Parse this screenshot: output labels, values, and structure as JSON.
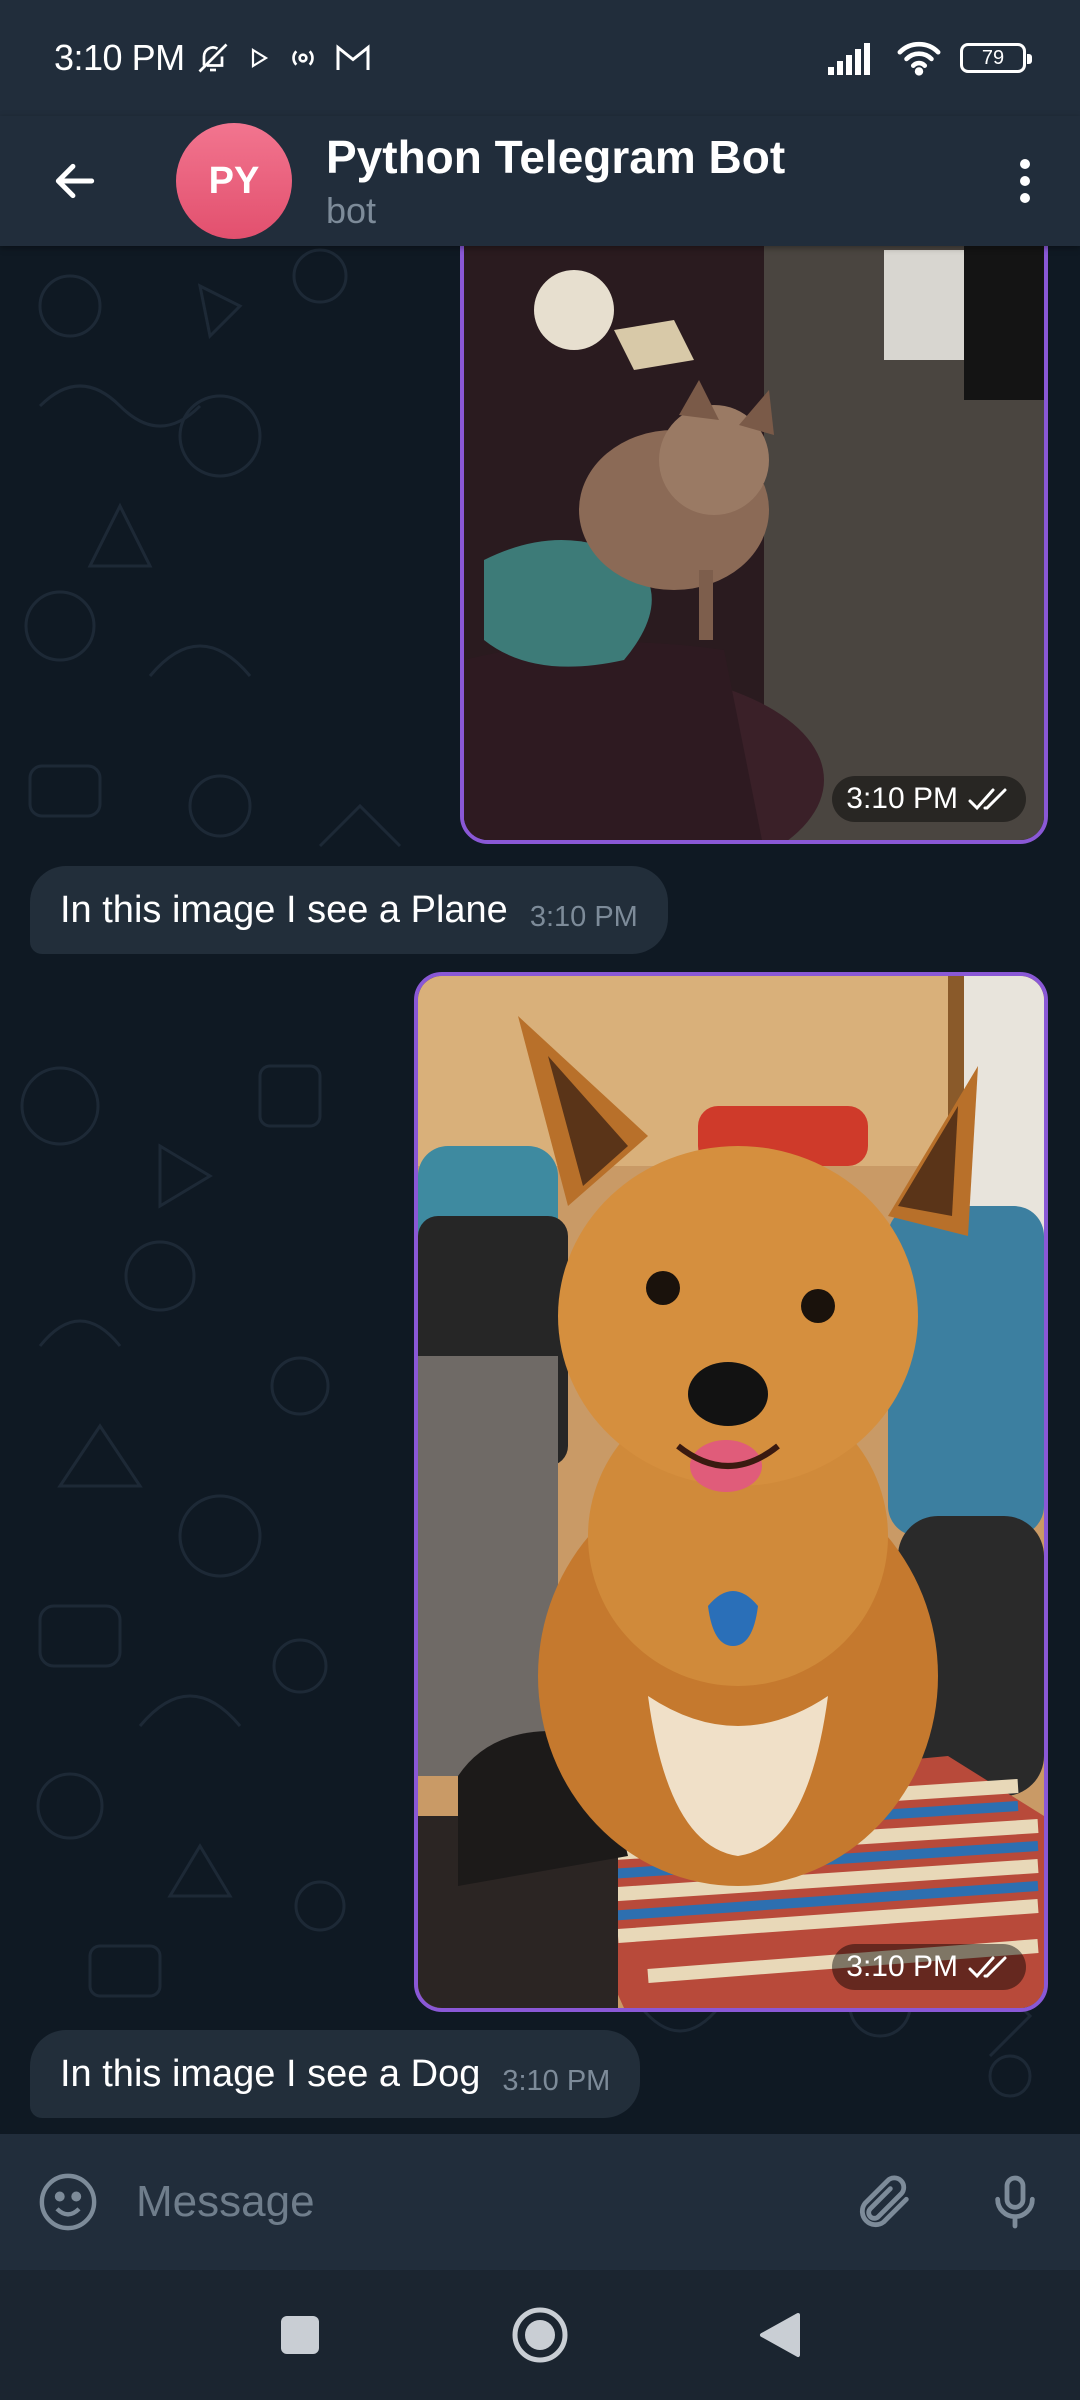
{
  "status_bar": {
    "time": "3:10 PM",
    "battery": "79",
    "icons": [
      "mute-bell-icon",
      "play-icon",
      "broadcast-icon",
      "gmail-icon",
      "signal-icon",
      "wifi-icon",
      "battery-icon"
    ]
  },
  "header": {
    "avatar_initials": "PY",
    "avatar_color": "#e85a78",
    "title": "Python Telegram Bot",
    "subtitle": "bot"
  },
  "messages": [
    {
      "type": "photo",
      "time": "3:10 PM",
      "status_icon": "double-check-icon"
    },
    {
      "type": "text",
      "text": "In this image I see a Plane",
      "time": "3:10 PM"
    },
    {
      "type": "photo",
      "time": "3:10 PM",
      "status_icon": "double-check-icon"
    },
    {
      "type": "text",
      "text": "In this image I see a Dog",
      "time": "3:10 PM"
    }
  ],
  "input": {
    "placeholder": "Message"
  },
  "colors": {
    "accent_border": "#8a58d6",
    "header_bg": "#212d3b",
    "chat_bg": "#0f1923",
    "bubble_bg": "#222e3a"
  }
}
